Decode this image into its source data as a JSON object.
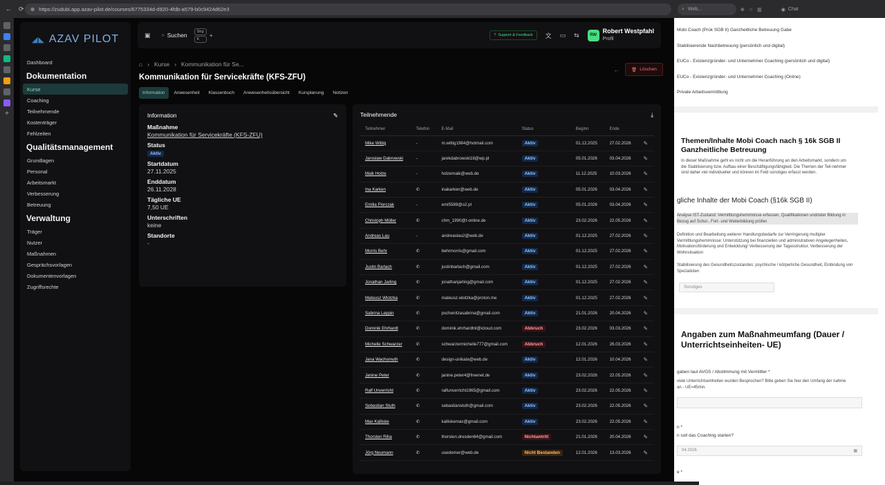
{
  "browser": {
    "url": "https://zudubi.app.azav-pilot.de/courses/6775334d-d920-4fdb-a579-b0c9424d62e3",
    "side_search": "Web...",
    "chat_label": "Chat"
  },
  "sidebar": {
    "logo": "AZAV PILOT",
    "top": "Dashboard",
    "sections": [
      {
        "heading": "Dokumentation",
        "items": [
          "Kurse",
          "Coaching",
          "Teilnehmende",
          "Kostenträger",
          "Fehlzeiten"
        ]
      },
      {
        "heading": "Qualitätsmanagement",
        "items": [
          "Grundlagen",
          "Personal",
          "Arbeitsmarkt",
          "Verbesserung",
          "Betreuung"
        ]
      },
      {
        "heading": "Verwaltung",
        "items": [
          "Träger",
          "Nutzer",
          "Maßnahmen",
          "Gesprächsvorlagen",
          "Dokumentenvorlagen",
          "Zugriffsrechte"
        ]
      }
    ]
  },
  "topbar": {
    "search": "Suchen",
    "kbd1": "Strg",
    "kbd2": "K",
    "plus": "+",
    "support": "Support & Feedback",
    "avatar": "RW",
    "user": "Robert Westpfahl",
    "profile": "Profil"
  },
  "breadcrumb": {
    "item1": "Kurse",
    "item2": "Kommunikation für Se..."
  },
  "page": {
    "title": "Kommunikation für Servicekräfte (KFS-ZFU)",
    "delete": "Löschen"
  },
  "tabs": [
    "Information",
    "Anwesenheit",
    "Klassenbuch",
    "Anwesenheitsübersicht",
    "Kursplanung",
    "Notizen"
  ],
  "info": {
    "heading": "Information",
    "massnahme_label": "Maßnahme",
    "massnahme": "Kommunikation für Servicekräfte (KFS-ZFU)",
    "status_label": "Status",
    "status": "Aktiv",
    "start_label": "Startdatum",
    "start": "27.11.2025",
    "end_label": "Enddatum",
    "end": "26.11.2028",
    "ue_label": "Tägliche UE",
    "ue": "7,50 UE",
    "sig_label": "Unterschriften",
    "sig": "keine",
    "loc_label": "Standorte",
    "loc": "-"
  },
  "participants": {
    "heading": "Teilnehmende",
    "columns": [
      "Teilnehmer",
      "Telefon",
      "E-Mail",
      "Status",
      "Beginn",
      "Ende"
    ],
    "rows": [
      {
        "name": "Mike Wittig",
        "phone": "-",
        "email": "m.wittig1984@hotmail.com",
        "status": "Aktiv",
        "s": "aktiv",
        "begin": "01.12.2025",
        "end": "27.02.2026"
      },
      {
        "name": "Jaroslaw Dabrowski",
        "phone": "-",
        "email": "jarekdabrowski18@wp.pl",
        "status": "Aktiv",
        "s": "aktiv",
        "begin": "05.01.2026",
        "end": "03.04.2026"
      },
      {
        "name": "Maik Holze",
        "phone": "-",
        "email": "holzemaik@web.de",
        "status": "Aktiv",
        "s": "aktiv",
        "begin": "11.12.2025",
        "end": "10.03.2026"
      },
      {
        "name": "Ina Karken",
        "phone": "✆",
        "email": "inakarken@web.de",
        "status": "Aktiv",
        "s": "aktiv",
        "begin": "05.01.2026",
        "end": "03.04.2026"
      },
      {
        "name": "Emilia Florczak",
        "phone": "-",
        "email": "emi5589@o2.pl",
        "status": "Aktiv",
        "s": "aktiv",
        "begin": "05.01.2026",
        "end": "03.04.2026"
      },
      {
        "name": "Christoph Müller",
        "phone": "✆",
        "email": "chm_1990@t-online.de",
        "status": "Aktiv",
        "s": "aktiv",
        "begin": "23.02.2026",
        "end": "22.05.2026"
      },
      {
        "name": "Andreas Lau",
        "phone": "-",
        "email": "andreaslau2@web.de",
        "status": "Aktiv",
        "s": "aktiv",
        "begin": "01.12.2025",
        "end": "27.02.2026"
      },
      {
        "name": "Morris Behr",
        "phone": "✆",
        "email": "behrmorris@gmail.com",
        "status": "Aktiv",
        "s": "aktiv",
        "begin": "01.12.2025",
        "end": "27.02.2026"
      },
      {
        "name": "Justin Barlach",
        "phone": "✆",
        "email": "justinbarlach@gmail.com",
        "status": "Aktiv",
        "s": "aktiv",
        "begin": "01.12.2025",
        "end": "27.02.2026"
      },
      {
        "name": "Jonathan Jarling",
        "phone": "✆",
        "email": "jonathanjarling@gmail.com",
        "status": "Aktiv",
        "s": "aktiv",
        "begin": "01.12.2025",
        "end": "27.02.2026"
      },
      {
        "name": "Mateusz Wlotzka",
        "phone": "✆",
        "email": "mateusz.wlotzka@proton.me",
        "status": "Aktiv",
        "s": "aktiv",
        "begin": "01.12.2025",
        "end": "27.02.2026"
      },
      {
        "name": "Sabrina Leppin",
        "phone": "✆",
        "email": "pschenitzasabrina@gmail.com",
        "status": "Aktiv",
        "s": "aktiv",
        "begin": "21.01.2026",
        "end": "20.04.2026"
      },
      {
        "name": "Dominik Ehrhardt",
        "phone": "✆",
        "email": "dominik.ehrhardtnl@icloud.com",
        "status": "Abbruch",
        "s": "abbruch",
        "begin": "23.02.2026",
        "end": "03.03.2026"
      },
      {
        "name": "Michelle Schwarzer",
        "phone": "✆",
        "email": "schwarzermichelle777@gmail.com",
        "status": "Abbruch",
        "s": "abbruch",
        "begin": "12.01.2026",
        "end": "26.03.2026"
      },
      {
        "name": "Jana Wachsmuth",
        "phone": "✆",
        "email": "design-unikate@web.de",
        "status": "Aktiv",
        "s": "aktiv",
        "begin": "12.01.2026",
        "end": "10.04.2026"
      },
      {
        "name": "Janine Peter",
        "phone": "✆",
        "email": "janine.peter4@freenet.de",
        "status": "Aktiv",
        "s": "aktiv",
        "begin": "23.02.2026",
        "end": "22.05.2026"
      },
      {
        "name": "Ralf Unverricht",
        "phone": "✆",
        "email": "ralfunverricht1965@gmail.com",
        "status": "Aktiv",
        "s": "aktiv",
        "begin": "23.02.2026",
        "end": "22.05.2026"
      },
      {
        "name": "Sebastian Stuth",
        "phone": "✆",
        "email": "sebastianstuth@gmail.com",
        "status": "Aktiv",
        "s": "aktiv",
        "begin": "23.02.2026",
        "end": "22.05.2026"
      },
      {
        "name": "Max Kalliske",
        "phone": "✆",
        "email": "kalliskemax@gmail.com",
        "status": "Aktiv",
        "s": "aktiv",
        "begin": "23.02.2026",
        "end": "22.05.2026"
      },
      {
        "name": "Thorsten Riha",
        "phone": "✆",
        "email": "thorsten.dresden64@gmail.com",
        "status": "Nichtantritt",
        "s": "nicht",
        "begin": "21.01.2026",
        "end": "20.04.2026"
      },
      {
        "name": "Jörg Neumann",
        "phone": "✆",
        "email": "usedomer@web.de",
        "status": "Nicht Bestanden",
        "s": "nb",
        "begin": "12.01.2026",
        "end": "13.03.2026"
      }
    ]
  },
  "rightpanel": {
    "l1": "Mobi Coach (Prok SGB II) Ganzheitliche Betreuung Gabe",
    "l2": "Stabilisierende Nachbetreuung (persönlich und digital)",
    "l3": "EUCo - Existenzgründer- und Unternehmer Coaching (persönlich und digital)",
    "l4": "EUCo - Existenzgründer- und Unternehmer Coaching (Online)",
    "l5": "Private Arbeitsvermittlung",
    "h1": "Themen/Inhalte Mobi Coach nach § 16k SGB II Ganzheitliche Betreuung",
    "p1": "In dieser Maßnahme geht es nicht um die Heranführung an den Arbeitsmarkt, sondern um die Stabilisierung bzw. Aufbau einer Beschäftigungsfähigkeit. Die Themen der Teil-nehmer sind daher viel individueller und können im Feld sonstiges erfasst werden.",
    "sub1": "gliche Inhalte der Mobi Coach (§16k SGB II)",
    "b1": "Analyse IST-Zustand: Vermittlungshemmnisse erfassen, Qualifikationen und/oder Bildung in Bezug auf Schul-, Fort- und Weiterbildung prüfen",
    "b2": "Definition und Bearbeitung weiterer Handlungsbedarfe zur Verringerung multipler Vermittlungshemmnisse: Unterstützung bei finanziellen und administrativen Angelegenheiten, Motivationsförderung und Entwicklung/ Verbesserung der Tagesstruktur, Verbesserung der Wohnsituation",
    "b3": "Stabilisierung des Gesundheitszustandes: psychische / körperliche Gesundheit, Einbindung von Spezialisten",
    "sonstiges": "Sonstiges",
    "h2": "Angaben zum Maßnahmeumfang (Dauer / Unterrichtseinheiten- UE)",
    "q1": "gaben laut AVGS / Abstimmung mit Vermittler  *",
    "q1d": "viele Unterrichtseinheiten wurden Besprochen? Bitte geben Sie hier den Umfang der nahme an - UE=45min.",
    "q2": "n *",
    "q2d": "n soll das Coaching starten?",
    "date": "04.2026",
    "q3": "e *"
  }
}
